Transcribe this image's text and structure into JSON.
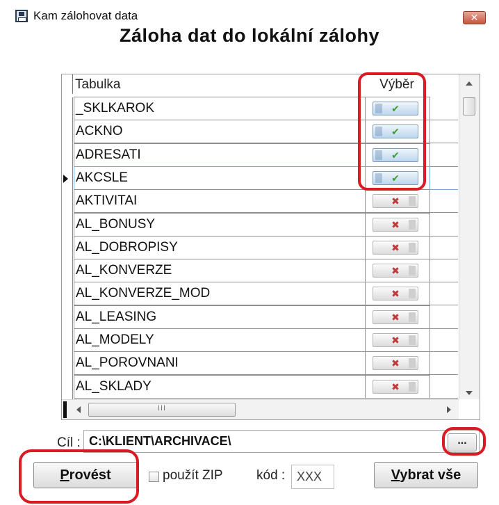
{
  "window": {
    "title": "Kam zálohovat data",
    "close_glyph": "✕",
    "heading": "Záloha dat do lokální zálohy"
  },
  "grid": {
    "columns": [
      "Tabulka",
      "Výběr"
    ],
    "current_row_index": 3,
    "rows": [
      {
        "name": "_SKLKAROK",
        "selected": true,
        "mark": "✔"
      },
      {
        "name": "ACKNO",
        "selected": true,
        "mark": "✔"
      },
      {
        "name": "ADRESATI",
        "selected": true,
        "mark": "✔"
      },
      {
        "name": "AKCSLE",
        "selected": true,
        "mark": "✔"
      },
      {
        "name": "AKTIVITAI",
        "selected": false,
        "mark": "✖"
      },
      {
        "name": "AL_BONUSY",
        "selected": false,
        "mark": "✖"
      },
      {
        "name": "AL_DOBROPISY",
        "selected": false,
        "mark": "✖"
      },
      {
        "name": "AL_KONVERZE",
        "selected": false,
        "mark": "✖"
      },
      {
        "name": "AL_KONVERZE_MOD",
        "selected": false,
        "mark": "✖"
      },
      {
        "name": "AL_LEASING",
        "selected": false,
        "mark": "✖"
      },
      {
        "name": "AL_MODELY",
        "selected": false,
        "mark": "✖"
      },
      {
        "name": "AL_POROVNANI",
        "selected": false,
        "mark": "✖"
      },
      {
        "name": "AL_SKLADY",
        "selected": false,
        "mark": "✖"
      }
    ],
    "hscroll_grip": "III"
  },
  "target": {
    "label": "Cíl :",
    "path": "C:\\KLIENT\\ARCHIVACE\\",
    "browse_label": "..."
  },
  "actions": {
    "execute_label": "Provést",
    "zip_label": "použít ZIP",
    "zip_checked": false,
    "code_label": "kód :",
    "code_value": "XXX",
    "select_all_label": "Vybrat vše"
  },
  "colors": {
    "annotation": "#d91b24",
    "check_on": "#3e9d2f",
    "check_off": "#c0393b"
  }
}
